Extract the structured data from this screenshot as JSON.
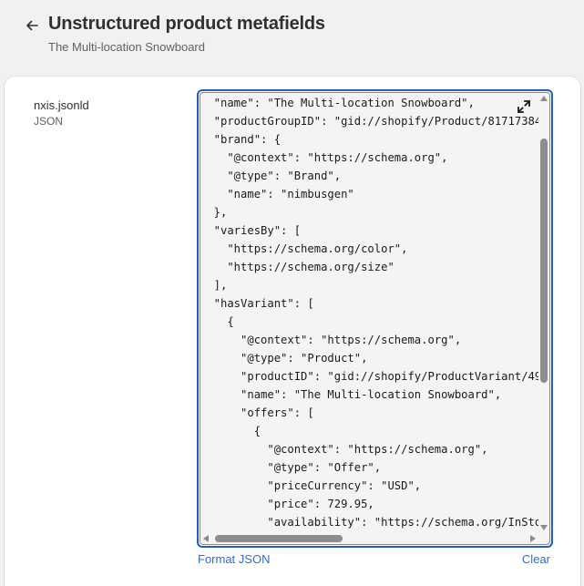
{
  "header": {
    "back_icon": "arrow-left-icon",
    "title": "Unstructured product metafields",
    "subtitle": "The Multi-location Snowboard"
  },
  "field": {
    "name": "nxis.jsonld",
    "type": "JSON"
  },
  "editor": {
    "expand_icon": "expand-diagonal-icon",
    "lines": [
      "  \"name\": \"The Multi-location Snowboard\",",
      "  \"productGroupID\": \"gid://shopify/Product/81717384",
      "  \"brand\": {",
      "    \"@context\": \"https://schema.org\",",
      "    \"@type\": \"Brand\",",
      "    \"name\": \"nimbusgen\"",
      "  },",
      "  \"variesBy\": [",
      "    \"https://schema.org/color\",",
      "    \"https://schema.org/size\"",
      "  ],",
      "  \"hasVariant\": [",
      "    {",
      "      \"@context\": \"https://schema.org\",",
      "      \"@type\": \"Product\",",
      "      \"productID\": \"gid://shopify/ProductVariant/49",
      "      \"name\": \"The Multi-location Snowboard\",",
      "      \"offers\": [",
      "        {",
      "          \"@context\": \"https://schema.org\",",
      "          \"@type\": \"Offer\",",
      "          \"priceCurrency\": \"USD\",",
      "          \"price\": 729.95,",
      "          \"availability\": \"https://schema.org/InSto"
    ]
  },
  "actions": {
    "format_label": "Format JSON",
    "clear_label": "Clear"
  },
  "colors": {
    "link": "#2c6ecb",
    "focus_border": "#1f5fc4",
    "background": "#f1f1f1"
  }
}
